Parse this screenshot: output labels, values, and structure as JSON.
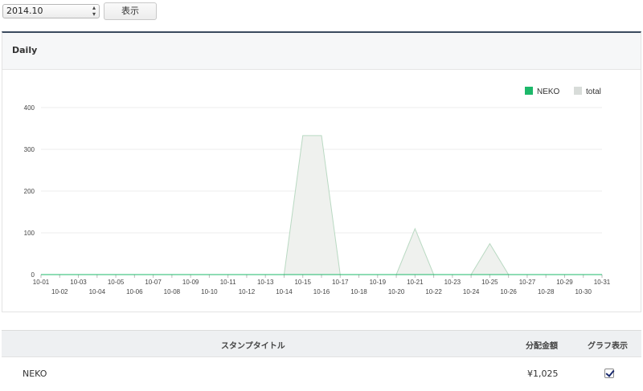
{
  "controls": {
    "month_value": "2014.10",
    "show_button_label": "表示"
  },
  "panel": {
    "title": "Daily"
  },
  "chart_data": {
    "type": "area",
    "x": [
      "10-01",
      "10-02",
      "10-03",
      "10-04",
      "10-05",
      "10-06",
      "10-07",
      "10-08",
      "10-09",
      "10-10",
      "10-11",
      "10-12",
      "10-13",
      "10-14",
      "10-15",
      "10-16",
      "10-17",
      "10-18",
      "10-19",
      "10-20",
      "10-21",
      "10-22",
      "10-23",
      "10-24",
      "10-25",
      "10-26",
      "10-27",
      "10-28",
      "10-29",
      "10-30",
      "10-31"
    ],
    "series": [
      {
        "name": "NEKO",
        "color": "#1db86a",
        "values": [
          0,
          0,
          0,
          0,
          0,
          0,
          0,
          0,
          0,
          0,
          0,
          0,
          0,
          0,
          0,
          0,
          0,
          0,
          0,
          0,
          0,
          0,
          0,
          0,
          0,
          0,
          0,
          0,
          0,
          0,
          0
        ]
      },
      {
        "name": "total",
        "color": "#d8dcd9",
        "values": [
          0,
          0,
          0,
          0,
          0,
          0,
          0,
          0,
          0,
          0,
          0,
          0,
          0,
          0,
          333,
          333,
          0,
          0,
          0,
          0,
          110,
          0,
          0,
          0,
          74,
          0,
          0,
          0,
          0,
          0,
          0
        ]
      }
    ],
    "yticks": [
      0,
      100,
      200,
      300,
      400
    ],
    "ylim": [
      0,
      400
    ],
    "grid": true,
    "legend_position": "top-right"
  },
  "table": {
    "headers": {
      "title": "スタンプタイトル",
      "amount": "分配金額",
      "graph": "グラフ表示"
    },
    "rows": [
      {
        "title": "NEKO",
        "amount": "¥1,025",
        "graph_checked": true
      }
    ]
  }
}
